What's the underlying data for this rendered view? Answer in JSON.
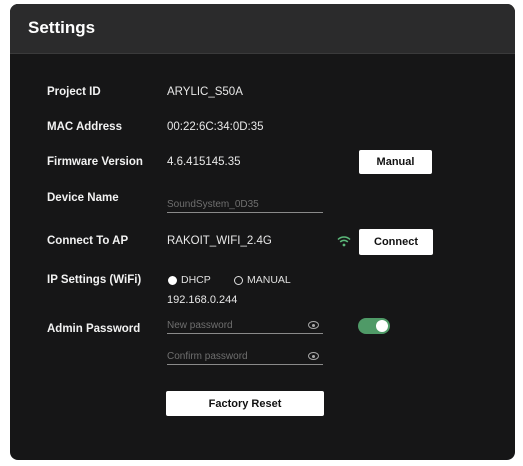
{
  "window": {
    "title": "Settings"
  },
  "rows": {
    "project_id": {
      "label": "Project ID",
      "value": "ARYLIC_S50A"
    },
    "mac_address": {
      "label": "MAC Address",
      "value": "00:22:6C:34:0D:35"
    },
    "firmware": {
      "label": "Firmware Version",
      "value": "4.6.415145.35",
      "button": "Manual"
    },
    "device_name": {
      "label": "Device Name",
      "placeholder": "SoundSystem_0D35"
    },
    "connect_ap": {
      "label": "Connect To AP",
      "value": "RAKOIT_WIFI_2.4G",
      "button": "Connect"
    },
    "ip_settings": {
      "label": "IP Settings (WiFi)",
      "option_dhcp": "DHCP",
      "option_manual": "MANUAL",
      "selected": "DHCP",
      "ip": "192.168.0.244"
    },
    "admin_password": {
      "label": "Admin Password",
      "new_placeholder": "New password",
      "confirm_placeholder": "Confirm password",
      "toggle_on": true
    }
  },
  "actions": {
    "factory_reset": "Factory Reset"
  },
  "colors": {
    "panel": "#161617",
    "header": "#2b2b2c",
    "toggle": "#4f9a67",
    "wifi": "#5cb87a"
  },
  "icons": [
    "wifi-icon",
    "eye-icon"
  ]
}
